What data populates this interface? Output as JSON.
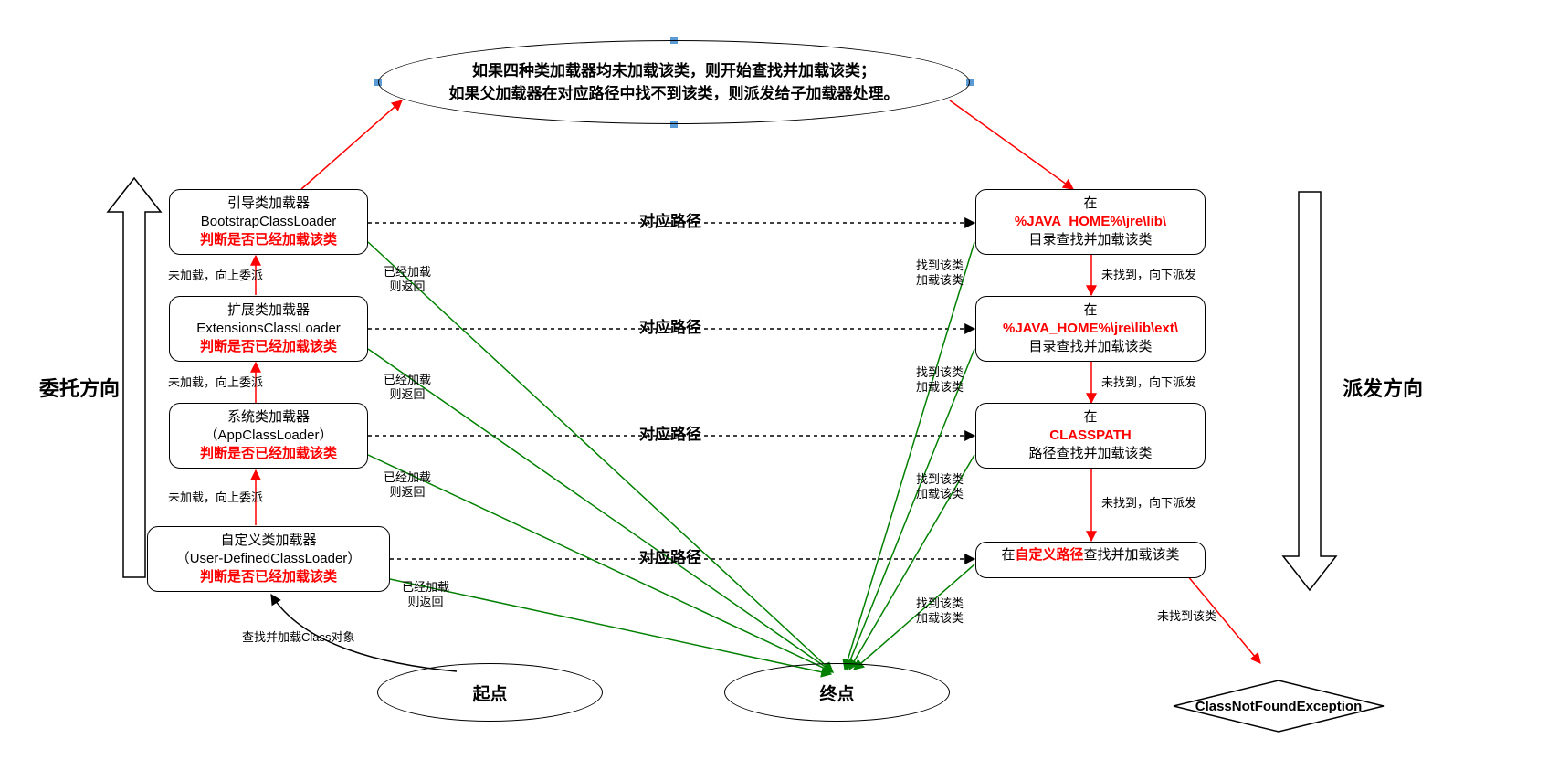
{
  "top_note": {
    "line1": "如果四种类加载器均未加载该类，则开始查找并加载该类；",
    "line2": "如果父加载器在对应路径中找不到该类，则派发给子加载器处理。"
  },
  "left_boxes": {
    "bootstrap": {
      "l1": "引导类加载器",
      "l2": "BootstrapClassLoader",
      "l3": "判断是否已经加载该类"
    },
    "ext": {
      "l1": "扩展类加载器",
      "l2": "ExtensionsClassLoader",
      "l3": "判断是否已经加载该类"
    },
    "app": {
      "l1": "系统类加载器",
      "l2": "（AppClassLoader）",
      "l3": "判断是否已经加载该类"
    },
    "user": {
      "l1": "自定义类加载器",
      "l2": "（User-DefinedClassLoader）",
      "l3": "判断是否已经加载该类"
    }
  },
  "right_boxes": {
    "bootstrap": {
      "l1": "在",
      "l2": "%JAVA_HOME%\\jre\\lib\\",
      "l3": "目录查找并加载该类"
    },
    "ext": {
      "l1": "在",
      "l2": "%JAVA_HOME%\\jre\\lib\\ext\\",
      "l3": "目录查找并加载该类"
    },
    "app": {
      "l1": "在",
      "l2": "CLASSPATH",
      "l3": "路径查找并加载该类"
    },
    "user": {
      "whole_pre": "在",
      "highlight": "自定义路径",
      "whole_post": "查找并加载该类"
    }
  },
  "left_direction": "委托方向",
  "right_direction": "派发方向",
  "start_label": "起点",
  "end_label": "终点",
  "exception_label": "ClassNotFoundException",
  "edge_labels": {
    "path": "对应路径",
    "up_delegate": "未加载，向上委派",
    "loaded_return_l1": "已经加载",
    "loaded_return_l2": "则返回",
    "down_dispatch": "未找到，向下派发",
    "found_l1": "找到该类",
    "found_l2": "加载该类",
    "not_found": "未找到该类",
    "start_edge": "查找并加载Class对象"
  }
}
